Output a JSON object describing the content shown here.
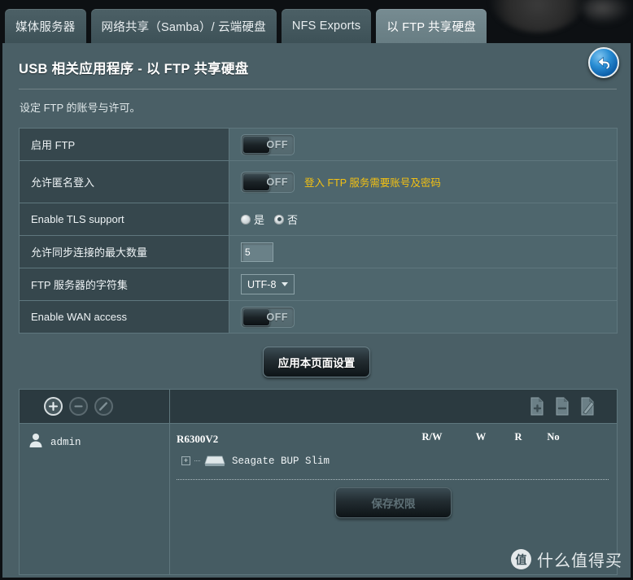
{
  "tabs": [
    {
      "label": "媒体服务器",
      "active": false
    },
    {
      "label": "网络共享（Samba）/ 云端硬盘",
      "active": false
    },
    {
      "label": "NFS Exports",
      "active": false
    },
    {
      "label": "以 FTP 共享硬盘",
      "active": true
    }
  ],
  "header": {
    "title": "USB 相关应用程序 - 以 FTP 共享硬盘",
    "subtitle": "设定 FTP 的账号与许可。",
    "back_icon": "back-arrow-icon"
  },
  "settings": {
    "rows": [
      {
        "label": "启用 FTP",
        "type": "toggle",
        "value": "OFF"
      },
      {
        "label": "允许匿名登入",
        "type": "toggle",
        "value": "OFF",
        "note": "登入 FTP 服务需要账号及密码"
      },
      {
        "label": "Enable TLS support",
        "type": "radio",
        "options": [
          "是",
          "否"
        ],
        "selected": "否"
      },
      {
        "label": "允许同步连接的最大数量",
        "type": "number",
        "value": "5"
      },
      {
        "label": "FTP 服务器的字符集",
        "type": "select",
        "value": "UTF-8"
      },
      {
        "label": "Enable WAN access",
        "type": "toggle",
        "value": "OFF"
      }
    ],
    "apply_label": "应用本页面设置"
  },
  "permissions": {
    "toolbar_left": [
      {
        "icon": "add-user-icon",
        "state": "active"
      },
      {
        "icon": "remove-user-icon",
        "state": "disabled"
      },
      {
        "icon": "edit-user-icon",
        "state": "disabled"
      }
    ],
    "toolbar_right": [
      {
        "icon": "add-folder-icon"
      },
      {
        "icon": "remove-folder-icon"
      },
      {
        "icon": "rename-folder-icon"
      }
    ],
    "users": [
      {
        "name": "admin",
        "icon": "user-icon"
      }
    ],
    "device_name": "R6300V2",
    "columns": [
      "R/W",
      "W",
      "R",
      "No"
    ],
    "tree": [
      {
        "label": "Seagate BUP Slim",
        "icon": "drive-icon",
        "expander": "+"
      }
    ],
    "save_label": "保存权限"
  },
  "watermark": {
    "badge": "值",
    "text": "什么值得买"
  },
  "colors": {
    "accent_yellow": "#f2c013",
    "panel_bg": "#4a5f66",
    "label_bg": "#36474d",
    "value_bg": "#4e666d",
    "tab_active": "#6d8288"
  }
}
